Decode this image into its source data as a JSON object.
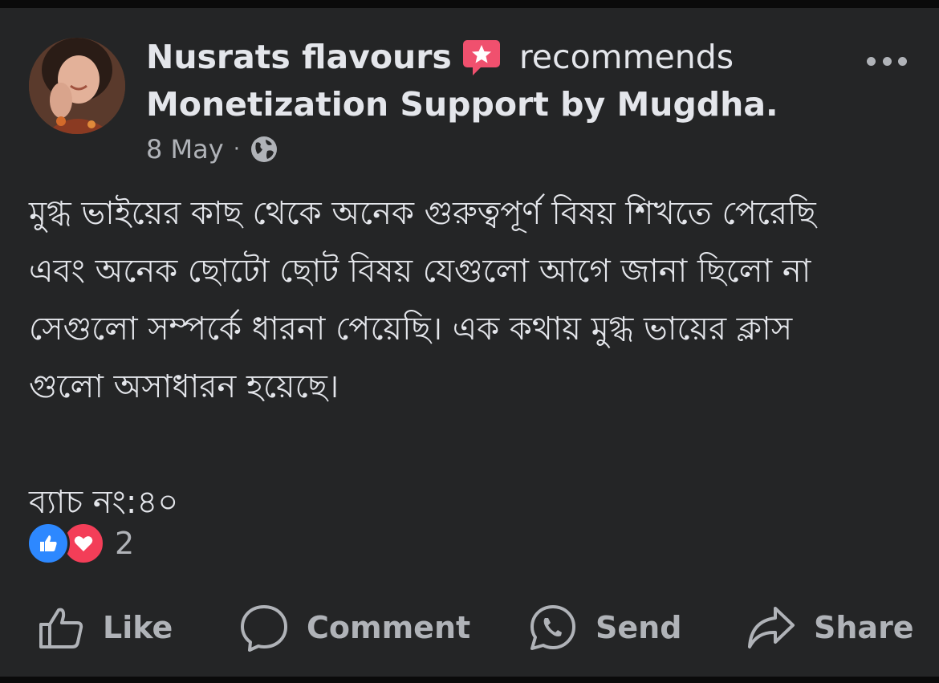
{
  "post": {
    "author_name": "Nusrats flavours",
    "action_text": "recommends",
    "page_name": "Monetization Support by Mugdha.",
    "date": "8 May",
    "meta_separator": "·",
    "body_lines": [
      "মুগ্ধ ভাইয়ের কাছ থেকে অনেক গুরুত্বপূর্ণ বিষয় শিখতে পেরেছি",
      "এবং অনেক ছোটো ছোট বিষয় যেগুলো আগে জানা ছিলো না",
      "সেগুলো সম্পর্কে ধারনা পেয়েছি। এক কথায় মুগ্ধ ভায়ের ক্লাস",
      "গুলো অসাধারন হয়েছে।"
    ],
    "batch_text": "ব্যাচ নং:৪০",
    "reaction_count": "2"
  },
  "actions": {
    "like": "Like",
    "comment": "Comment",
    "send": "Send",
    "share": "Share"
  },
  "icons": {
    "badge": "recommendation-star-icon",
    "privacy": "globe-icon",
    "more": "more-options-icon",
    "like_reaction": "like-reaction-icon",
    "love_reaction": "love-reaction-icon"
  },
  "colors": {
    "background": "#242526",
    "text_primary": "#e4e6eb",
    "text_secondary": "#b0b3b8",
    "like_blue": "#2d88ff",
    "love_red": "#f33e58",
    "badge_red": "#f0506e"
  }
}
